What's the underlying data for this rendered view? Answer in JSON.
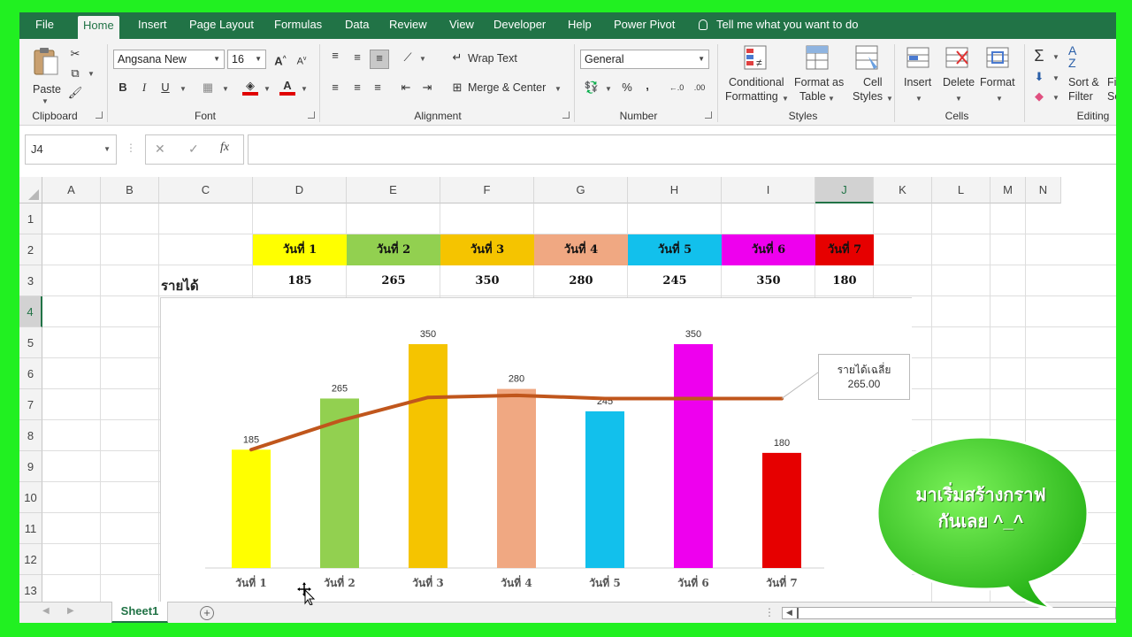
{
  "ribbon_tabs": [
    "File",
    "Home",
    "Insert",
    "Page Layout",
    "Formulas",
    "Data",
    "Review",
    "View",
    "Developer",
    "Help",
    "Power Pivot"
  ],
  "tell_me": "Tell me what you want to do",
  "clipboard": {
    "paste": "Paste",
    "label": "Clipboard"
  },
  "font": {
    "name": "Angsana New",
    "size": "16",
    "label": "Font",
    "bold": "B",
    "italic": "I",
    "underline": "U",
    "grow": "A",
    "shrink": "A",
    "fontcolor": "A"
  },
  "alignment": {
    "wrap": "Wrap Text",
    "merge": "Merge & Center",
    "label": "Alignment"
  },
  "number": {
    "format": "General",
    "label": "Number",
    "percent": "%",
    "comma": ","
  },
  "styles": {
    "cond_line1": "Conditional",
    "cond_line2": "Formatting",
    "fmt_line1": "Format as",
    "fmt_line2": "Table",
    "cell_line1": "Cell",
    "cell_line2": "Styles",
    "label": "Styles"
  },
  "cells": {
    "insert": "Insert",
    "delete": "Delete",
    "format": "Format",
    "label": "Cells"
  },
  "editing": {
    "sort_line1": "Sort &",
    "sort_line2": "Filter",
    "find": "Fi",
    "find2": "Se",
    "label": "Editing"
  },
  "formula_bar": {
    "name_box": "J4",
    "fx": "fx",
    "cancel": "✕",
    "enter": "✓",
    "content": ""
  },
  "columns": [
    "A",
    "B",
    "C",
    "D",
    "E",
    "F",
    "G",
    "H",
    "I",
    "J",
    "K",
    "L",
    "M",
    "N"
  ],
  "rows": [
    "1",
    "2",
    "3",
    "4",
    "5",
    "6",
    "7",
    "8",
    "9",
    "10",
    "11",
    "12",
    "13"
  ],
  "income_label": "รายได้",
  "days": [
    {
      "label": "วันที่ 1",
      "value": "185",
      "color": "#ffff00",
      "text": "#111111"
    },
    {
      "label": "วันที่ 2",
      "value": "265",
      "color": "#92d050",
      "text": "#111111"
    },
    {
      "label": "วันที่ 3",
      "value": "350",
      "color": "#f5c400",
      "text": "#111111"
    },
    {
      "label": "วันที่ 4",
      "value": "280",
      "color": "#f0a882",
      "text": "#111111"
    },
    {
      "label": "วันที่ 5",
      "value": "245",
      "color": "#12c0ec",
      "text": "#111111"
    },
    {
      "label": "วันที่ 6",
      "value": "350",
      "color": "#ee00ee",
      "text": "#111111"
    },
    {
      "label": "วันที่ 7",
      "value": "180",
      "color": "#e60000",
      "text": "#111111"
    }
  ],
  "chart_data": {
    "type": "bar",
    "categories": [
      "วันที่ 1",
      "วันที่ 2",
      "วันที่ 3",
      "วันที่ 4",
      "วันที่ 5",
      "วันที่ 6",
      "วันที่ 7"
    ],
    "values": [
      185,
      265,
      350,
      280,
      245,
      350,
      180
    ],
    "bar_colors": [
      "#ffff00",
      "#92d050",
      "#f5c400",
      "#f0a882",
      "#12c0ec",
      "#ee00ee",
      "#e60000"
    ],
    "line_series": {
      "values": [
        185,
        230,
        266.7,
        270,
        265,
        265,
        265
      ],
      "color": "#c0561c"
    },
    "avg_callout": {
      "label": "รายได้เฉลี่ย",
      "value": "265.00"
    },
    "ylim": [
      0,
      350
    ],
    "grid": false,
    "title": "",
    "xlabel": "",
    "ylabel": ""
  },
  "bubble": {
    "line1": "มาเริ่มสร้างกราฟ",
    "line2": "กันเลย ^_^",
    "color": "#2fc21a"
  },
  "sheet": {
    "tab": "Sheet1",
    "add": "+"
  }
}
